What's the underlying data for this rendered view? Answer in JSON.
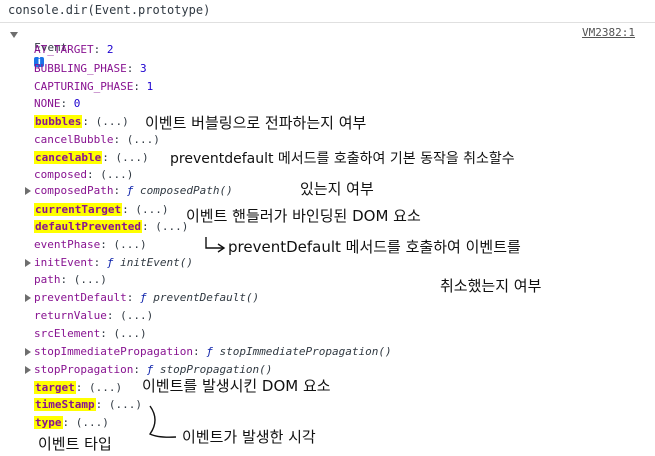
{
  "command": "console.dir(Event.prototype)",
  "source_link": "VM2382:1",
  "object": {
    "label": "Event",
    "info_icon": "i"
  },
  "rows": [
    {
      "key": "AT_TARGET",
      "sep": ": ",
      "val": "2"
    },
    {
      "key": "BUBBLING_PHASE",
      "sep": ": ",
      "val": "3"
    },
    {
      "key": "CAPTURING_PHASE",
      "sep": ": ",
      "val": "1"
    },
    {
      "key": "NONE",
      "sep": ": ",
      "val": "0"
    },
    {
      "key": "bubbles",
      "sep": ": ",
      "val": "(...)"
    },
    {
      "key": "cancelBubble",
      "sep": ": ",
      "val": "(...)"
    },
    {
      "key": "cancelable",
      "sep": ": ",
      "val": "(...)"
    },
    {
      "key": "composed",
      "sep": ": ",
      "val": "(...)"
    },
    {
      "key": "composedPath",
      "sep": ": ",
      "f": "ƒ",
      "fname": "composedPath()"
    },
    {
      "key": "currentTarget",
      "sep": ": ",
      "val": "(...)"
    },
    {
      "key": "defaultPrevented",
      "sep": ": ",
      "val": "(...)"
    },
    {
      "key": "eventPhase",
      "sep": ": ",
      "val": "(...)"
    },
    {
      "key": "initEvent",
      "sep": ": ",
      "f": "ƒ",
      "fname": "initEvent()"
    },
    {
      "key": "path",
      "sep": ": ",
      "val": "(...)"
    },
    {
      "key": "preventDefault",
      "sep": ": ",
      "f": "ƒ",
      "fname": "preventDefault()"
    },
    {
      "key": "returnValue",
      "sep": ": ",
      "val": "(...)"
    },
    {
      "key": "srcElement",
      "sep": ": ",
      "val": "(...)"
    },
    {
      "key": "stopImmediatePropagation",
      "sep": ": ",
      "f": "ƒ",
      "fname": "stopImmediatePropagation()"
    },
    {
      "key": "stopPropagation",
      "sep": ": ",
      "f": "ƒ",
      "fname": "stopPropagation()"
    },
    {
      "key": "target",
      "sep": ": ",
      "val": "(...)"
    },
    {
      "key": "timeStamp",
      "sep": ": ",
      "val": "(...)"
    },
    {
      "key": "type",
      "sep": ": ",
      "val": "(...)"
    }
  ],
  "annotations": {
    "bubbles": "이벤트 버블링으로 전파하는지 여부",
    "cancelable_1": "preventdefault 메서드를 호출하여 기본 동작을 취소할수",
    "cancelable_2": "있는지 여부",
    "currentTarget": "이벤트 핸들러가 바인딩된 DOM 요소",
    "defaultPrevented_1": "preventDefault 메서드를 호출하여 이벤트를",
    "defaultPrevented_2": "취소했는지 여부",
    "target": "이벤트를 발생시킨 DOM 요소",
    "timeStamp": "이벤트가 발생한 시각",
    "type": "이벤트 타입"
  },
  "colors": {
    "highlight": "#ffff00",
    "key": "#881391",
    "number": "#1c00cf",
    "link": "#545454"
  }
}
